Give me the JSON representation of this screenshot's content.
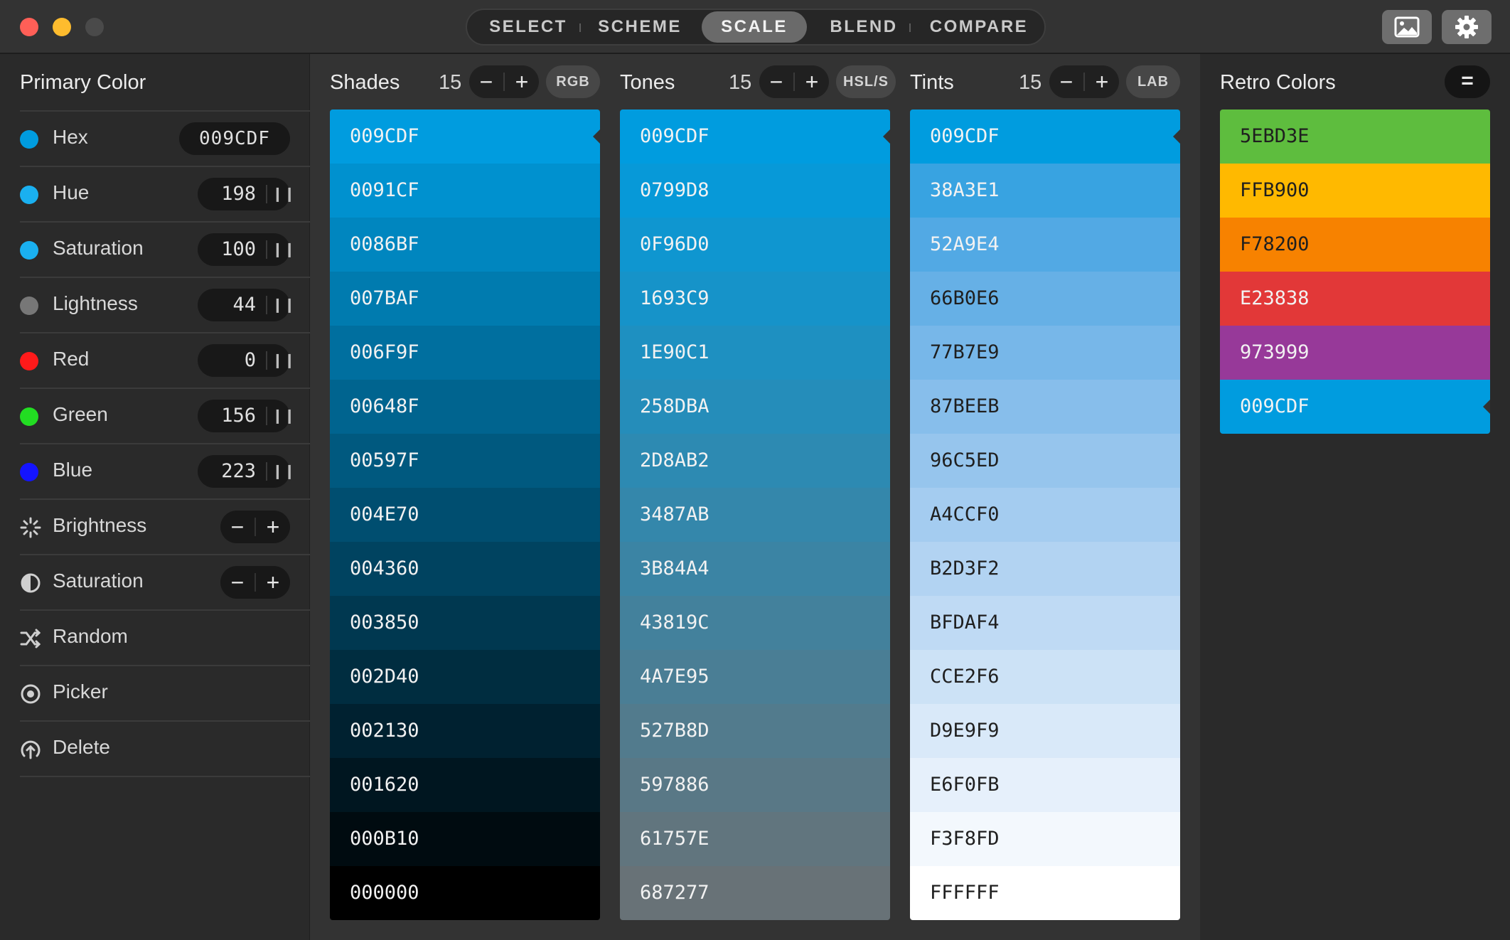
{
  "toolbar": {
    "tabs": [
      {
        "label": "SELECT",
        "active": false
      },
      {
        "label": "SCHEME",
        "active": false
      },
      {
        "label": "SCALE",
        "active": true
      },
      {
        "label": "BLEND",
        "active": false
      },
      {
        "label": "COMPARE",
        "active": false
      }
    ],
    "icons": [
      "image-icon",
      "gear-icon"
    ]
  },
  "sidebar": {
    "title": "Primary Color",
    "hex": {
      "label": "Hex",
      "value": "009CDF",
      "dot_color": "#009CDF"
    },
    "sliders": [
      {
        "label": "Hue",
        "value": "198",
        "dot_color": "#1AB0F0"
      },
      {
        "label": "Saturation",
        "value": "100",
        "dot_color": "#1AB0F0"
      },
      {
        "label": "Lightness",
        "value": "44",
        "dot_color": "#777777"
      },
      {
        "label": "Red",
        "value": "0",
        "dot_color": "#FF1A1A"
      },
      {
        "label": "Green",
        "value": "156",
        "dot_color": "#22DD22"
      },
      {
        "label": "Blue",
        "value": "223",
        "dot_color": "#1414FF"
      }
    ],
    "adjusters": [
      {
        "label": "Brightness",
        "icon": "brightness-icon"
      },
      {
        "label": "Saturation",
        "icon": "contrast-icon"
      }
    ],
    "actions": [
      {
        "label": "Random",
        "icon": "shuffle-icon"
      },
      {
        "label": "Picker",
        "icon": "target-icon"
      },
      {
        "label": "Delete",
        "icon": "delete-icon"
      }
    ]
  },
  "scales": [
    {
      "title": "Shades",
      "count": "15",
      "mode": "RGB",
      "swatches": [
        "009CDF",
        "0091CF",
        "0086BF",
        "007BAF",
        "006F9F",
        "00648F",
        "00597F",
        "004E70",
        "004360",
        "003850",
        "002D40",
        "002130",
        "001620",
        "000B10",
        "000000"
      ]
    },
    {
      "title": "Tones",
      "count": "15",
      "mode": "HSL/S",
      "swatches": [
        "009CDF",
        "0799D8",
        "0F96D0",
        "1693C9",
        "1E90C1",
        "258DBA",
        "2D8AB2",
        "3487AB",
        "3B84A4",
        "43819C",
        "4A7E95",
        "527B8D",
        "597886",
        "61757E",
        "687277"
      ]
    },
    {
      "title": "Tints",
      "count": "15",
      "mode": "LAB",
      "swatches": [
        "009CDF",
        "38A3E1",
        "52A9E4",
        "66B0E6",
        "77B7E9",
        "87BEEB",
        "96C5ED",
        "A4CCF0",
        "B2D3F2",
        "BFDAF4",
        "CCE2F6",
        "D9E9F9",
        "E6F0FB",
        "F3F8FD",
        "FFFFFF"
      ]
    }
  ],
  "retro": {
    "title": "Retro Colors",
    "menu_label": "=",
    "swatches": [
      "5EBD3E",
      "FFB900",
      "F78200",
      "E23838",
      "973999",
      "009CDF"
    ]
  }
}
